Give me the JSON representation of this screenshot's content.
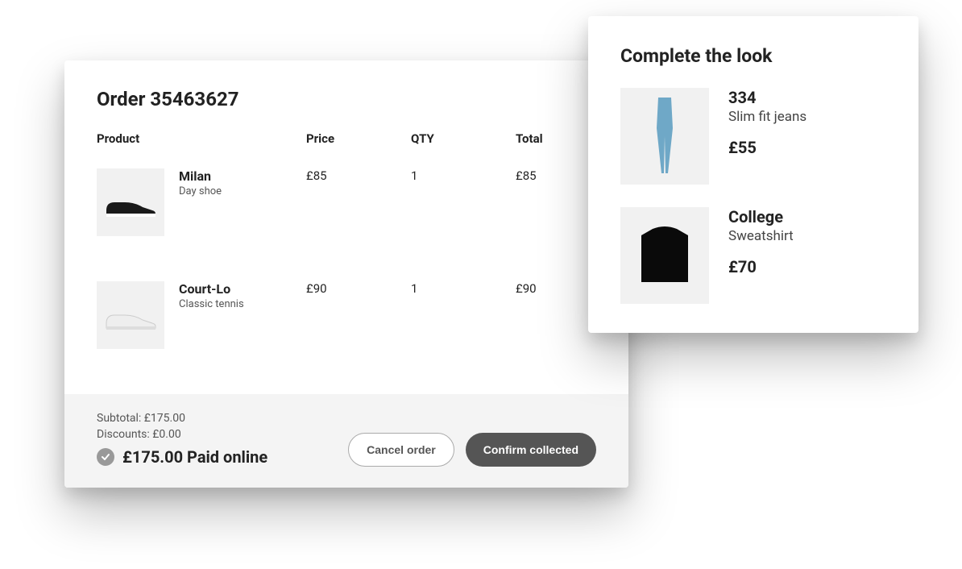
{
  "order": {
    "title": "Order 35463627",
    "columns": {
      "product": "Product",
      "price": "Price",
      "qty": "QTY",
      "total": "Total"
    },
    "items": [
      {
        "name": "Milan",
        "sub": "Day shoe",
        "price": "£85",
        "qty": "1",
        "total": "£85",
        "icon": "shoe-dark"
      },
      {
        "name": "Court-Lo",
        "sub": "Classic tennis",
        "price": "£90",
        "qty": "1",
        "total": "£90",
        "icon": "shoe-light"
      }
    ],
    "summary": {
      "subtotal": "Subtotal: £175.00",
      "discounts": "Discounts: £0.00",
      "paid": "£175.00 Paid online"
    },
    "buttons": {
      "cancel": "Cancel order",
      "confirm": "Confirm collected"
    }
  },
  "look": {
    "title": "Complete the look",
    "items": [
      {
        "name": "334",
        "sub": "Slim fit jeans",
        "price": "£55",
        "icon": "jeans"
      },
      {
        "name": "College",
        "sub": "Sweatshirt",
        "price": "£70",
        "icon": "sweatshirt"
      }
    ]
  }
}
